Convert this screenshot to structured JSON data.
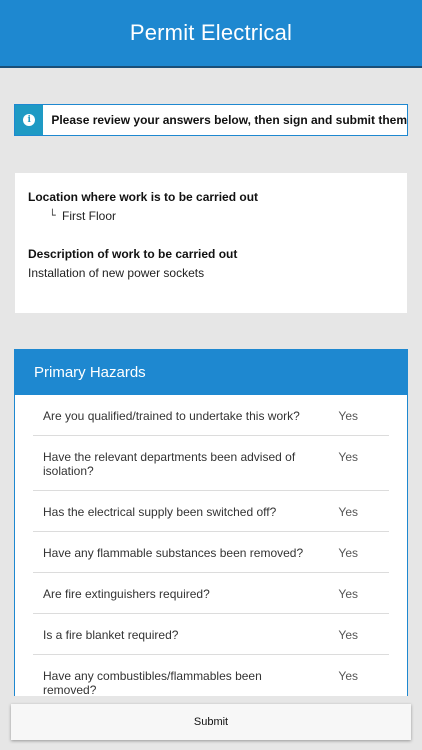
{
  "header": {
    "title": "Permit Electrical"
  },
  "notice": {
    "icon": "info-icon",
    "text": "Please review your answers below, then sign and submit them"
  },
  "summary": {
    "location_label": "Location where work is to be carried out",
    "location_value": "First Floor",
    "description_label": "Description of work to be carried out",
    "description_value": "Installation of new power sockets"
  },
  "hazards": {
    "title": "Primary Hazards",
    "items": [
      {
        "question": "Are you qualified/trained to undertake this work?",
        "answer": "Yes"
      },
      {
        "question": "Have the relevant departments been advised of isolation?",
        "answer": "Yes"
      },
      {
        "question": "Has the electrical supply been switched off?",
        "answer": "Yes"
      },
      {
        "question": "Have any flammable substances been removed?",
        "answer": "Yes"
      },
      {
        "question": "Are fire extinguishers required?",
        "answer": "Yes"
      },
      {
        "question": "Is a fire blanket required?",
        "answer": "Yes"
      },
      {
        "question": "Have any combustibles/flammables been removed?",
        "answer": "Yes"
      }
    ]
  },
  "footer": {
    "submit_label": "Submit"
  },
  "colors": {
    "primary": "#1e88d0",
    "info_accent": "#1e9ac4",
    "background": "#e6e6e6"
  }
}
